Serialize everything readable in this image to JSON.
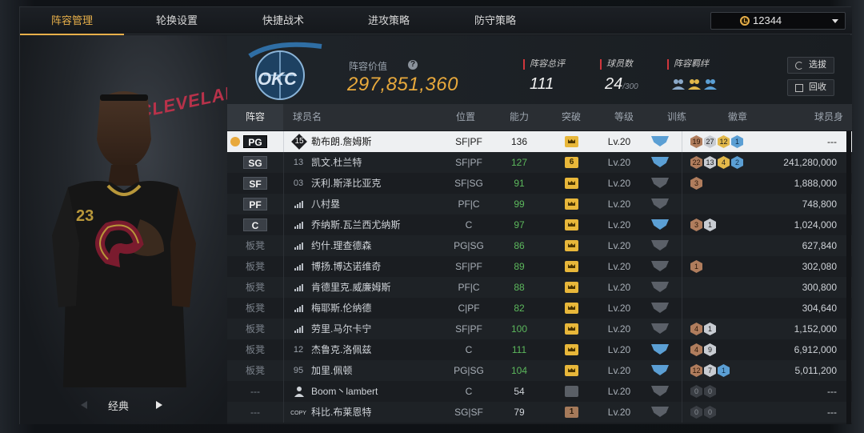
{
  "tabs": [
    {
      "label": "阵容管理",
      "active": true
    },
    {
      "label": "轮换设置",
      "active": false
    },
    {
      "label": "快捷战术",
      "active": false
    },
    {
      "label": "进攻策略",
      "active": false
    },
    {
      "label": "防守策略",
      "active": false
    }
  ],
  "currency": {
    "amount": "12344",
    "icon": "clock-icon"
  },
  "lineup": {
    "value_label": "阵容价值",
    "value": "297,851,360",
    "rating_label": "阵容总评",
    "rating": "111",
    "players_label": "球员数",
    "players_count": "24",
    "players_max": "/300",
    "bond_label": "阵容羁绊"
  },
  "buttons": {
    "filter": "选拔",
    "recall": "回收"
  },
  "featured": {
    "label": "经典",
    "team_text": "CLEVELAND"
  },
  "columns": [
    "阵容",
    "球员名",
    "位置",
    "能力",
    "突破",
    "等级",
    "训练",
    "徽章",
    "球员身价"
  ],
  "colors": {
    "accent": "#e8b04a",
    "green": "#5cb85c",
    "blue": "#5b9fd4"
  },
  "rows": [
    {
      "slot": "PG",
      "starter": true,
      "num": "15",
      "num_style": "diamond",
      "name": "勒布朗.詹姆斯",
      "pos": "SF|PF",
      "ability": "136",
      "green": false,
      "break": "",
      "break_style": "crown",
      "level": "Lv.20",
      "train": "blue",
      "badges": [
        [
          "19",
          "bronze"
        ],
        [
          "27",
          "silver"
        ],
        [
          "12",
          "gold"
        ],
        [
          "1",
          "blue"
        ]
      ],
      "price": "---"
    },
    {
      "slot": "SG",
      "starter": true,
      "num": "13",
      "num_style": "plain",
      "name": "凯文.杜兰特",
      "pos": "SF|PF",
      "ability": "127",
      "green": true,
      "break": "6",
      "break_style": "num",
      "level": "Lv.20",
      "train": "blue",
      "badges": [
        [
          "22",
          "bronze"
        ],
        [
          "13",
          "silver"
        ],
        [
          "4",
          "gold"
        ],
        [
          "2",
          "blue"
        ]
      ],
      "price": "241,280,000"
    },
    {
      "slot": "SF",
      "starter": true,
      "num": "03",
      "num_style": "plain",
      "name": "沃利.斯泽比亚克",
      "pos": "SF|SG",
      "ability": "91",
      "green": true,
      "break": "",
      "break_style": "crown",
      "level": "Lv.20",
      "train": "gray",
      "badges": [
        [
          "3",
          "bronze"
        ]
      ],
      "price": "1,888,000"
    },
    {
      "slot": "PF",
      "starter": true,
      "num": "",
      "num_style": "bars",
      "name": "八村塁",
      "pos": "PF|C",
      "ability": "99",
      "green": true,
      "break": "",
      "break_style": "crown",
      "level": "Lv.20",
      "train": "gray",
      "badges": [],
      "price": "748,800"
    },
    {
      "slot": "C",
      "starter": true,
      "num": "",
      "num_style": "bars",
      "name": "乔纳斯.瓦兰西尤纳斯",
      "pos": "C",
      "ability": "97",
      "green": true,
      "break": "",
      "break_style": "crown",
      "level": "Lv.20",
      "train": "blue",
      "badges": [
        [
          "3",
          "bronze"
        ],
        [
          "1",
          "silver"
        ]
      ],
      "price": "1,024,000"
    },
    {
      "slot": "板凳",
      "starter": false,
      "num": "",
      "num_style": "bars",
      "name": "约什.理查德森",
      "pos": "PG|SG",
      "ability": "86",
      "green": true,
      "break": "",
      "break_style": "crown",
      "level": "Lv.20",
      "train": "gray",
      "badges": [],
      "price": "627,840"
    },
    {
      "slot": "板凳",
      "starter": false,
      "num": "",
      "num_style": "bars",
      "name": "博扬.博达诺维奇",
      "pos": "SF|PF",
      "ability": "89",
      "green": true,
      "break": "",
      "break_style": "crown",
      "level": "Lv.20",
      "train": "gray",
      "badges": [
        [
          "1",
          "bronze"
        ]
      ],
      "price": "302,080"
    },
    {
      "slot": "板凳",
      "starter": false,
      "num": "",
      "num_style": "bars",
      "name": "肯德里克.威廉姆斯",
      "pos": "PF|C",
      "ability": "88",
      "green": true,
      "break": "",
      "break_style": "crown",
      "level": "Lv.20",
      "train": "gray",
      "badges": [],
      "price": "300,800"
    },
    {
      "slot": "板凳",
      "starter": false,
      "num": "",
      "num_style": "bars",
      "name": "梅耶斯.伦纳德",
      "pos": "C|PF",
      "ability": "82",
      "green": true,
      "break": "",
      "break_style": "crown",
      "level": "Lv.20",
      "train": "gray",
      "badges": [],
      "price": "304,640"
    },
    {
      "slot": "板凳",
      "starter": false,
      "num": "",
      "num_style": "bars",
      "name": "劳里.马尔卡宁",
      "pos": "SF|PF",
      "ability": "100",
      "green": true,
      "break": "",
      "break_style": "crown",
      "level": "Lv.20",
      "train": "gray",
      "badges": [
        [
          "4",
          "bronze"
        ],
        [
          "1",
          "silver"
        ]
      ],
      "price": "1,152,000"
    },
    {
      "slot": "板凳",
      "starter": false,
      "num": "12",
      "num_style": "plain",
      "name": "杰鲁克.洛佩兹",
      "pos": "C",
      "ability": "111",
      "green": true,
      "break": "",
      "break_style": "crown",
      "level": "Lv.20",
      "train": "blue",
      "badges": [
        [
          "4",
          "bronze"
        ],
        [
          "9",
          "silver"
        ]
      ],
      "price": "6,912,000"
    },
    {
      "slot": "板凳",
      "starter": false,
      "num": "95",
      "num_style": "plain",
      "name": "加里.佩顿",
      "pos": "PG|SG",
      "ability": "104",
      "green": true,
      "break": "",
      "break_style": "crown",
      "level": "Lv.20",
      "train": "blue",
      "badges": [
        [
          "12",
          "bronze"
        ],
        [
          "7",
          "silver"
        ],
        [
          "1",
          "blue"
        ]
      ],
      "price": "5,011,200"
    },
    {
      "slot": "---",
      "starter": false,
      "num": "",
      "num_style": "person",
      "name": "Boom丶lambert",
      "pos": "C",
      "ability": "54",
      "green": false,
      "break": "",
      "break_style": "dim",
      "level": "Lv.20",
      "train": "gray",
      "badges": [
        [
          "0",
          "empty"
        ],
        [
          "0",
          "empty"
        ]
      ],
      "price": "---"
    },
    {
      "slot": "---",
      "starter": false,
      "num": "COPY",
      "num_style": "copy",
      "name": "科比.布莱恩特",
      "pos": "SG|SF",
      "ability": "79",
      "green": false,
      "break": "1",
      "break_style": "bronze",
      "level": "Lv.20",
      "train": "gray",
      "badges": [
        [
          "0",
          "empty"
        ],
        [
          "0",
          "empty"
        ]
      ],
      "price": "---"
    }
  ]
}
